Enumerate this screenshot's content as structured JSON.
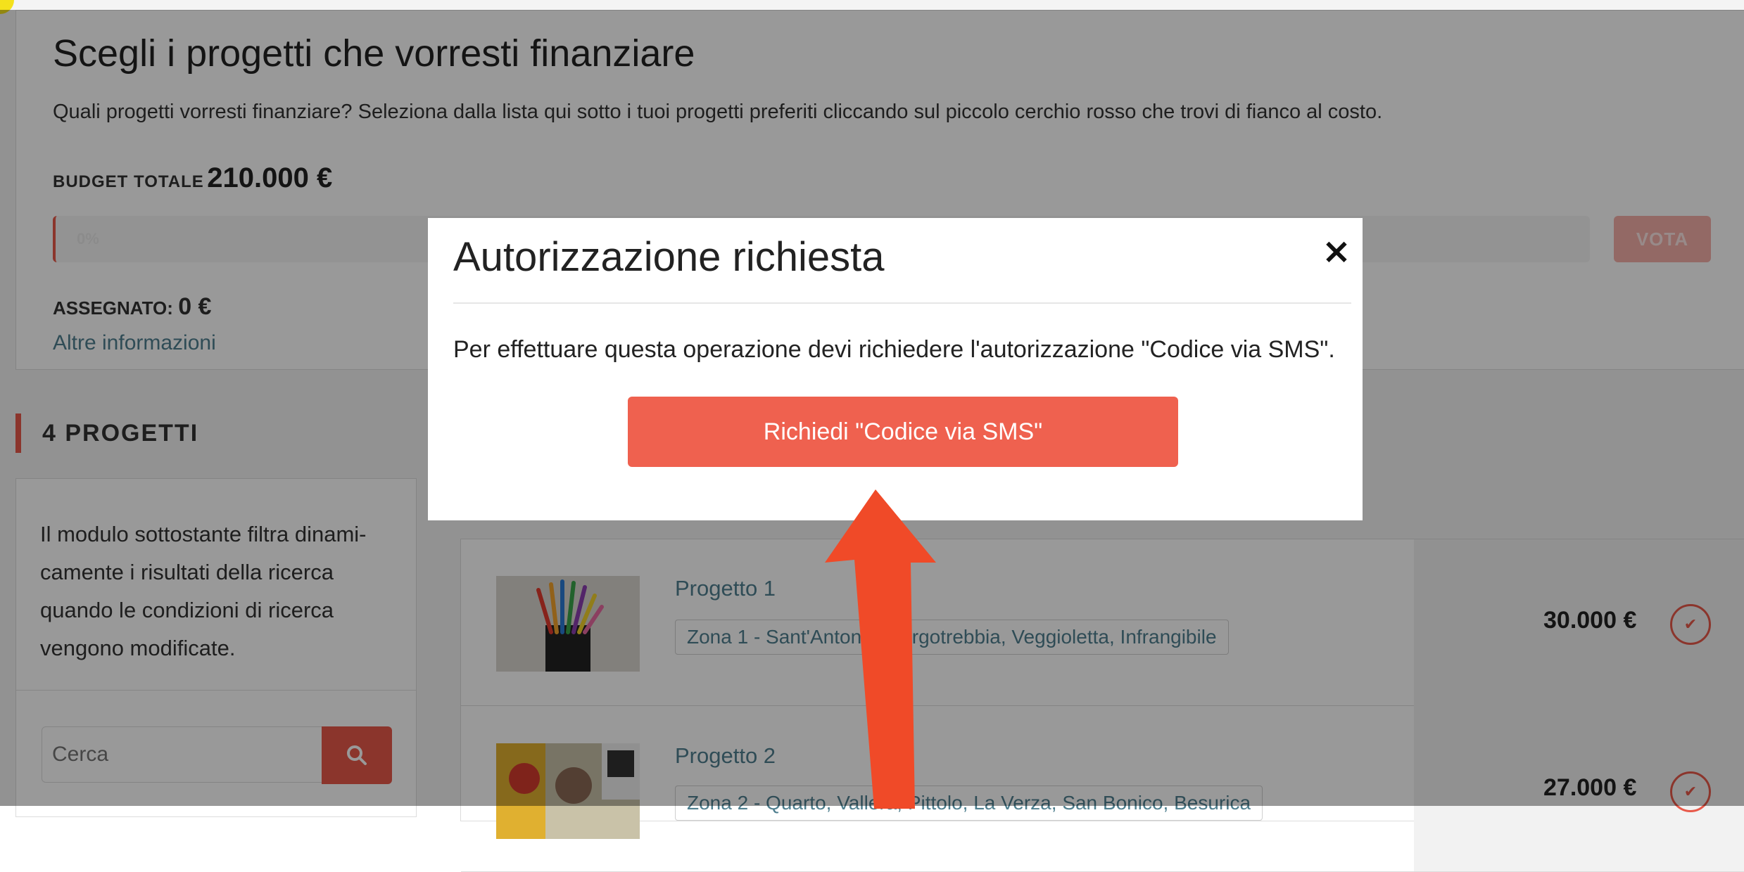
{
  "header": {
    "title": "Scegli i progetti che vorresti finanziare",
    "description": "Quali progetti vorresti finanziare? Seleziona dalla lista qui sotto i tuoi progetti preferiti cliccando sul piccolo cerchio rosso che trovi di fianco al costo.",
    "budget_label": "BUDGET TOTALE",
    "budget_value": "210.000 €",
    "progress_label": "0%",
    "progress_fraction": 0,
    "vote_button": "VOTA",
    "assigned_label": "ASSEGNATO:",
    "assigned_value": "0 €",
    "more_info_link": "Altre informazioni"
  },
  "projects": {
    "count_label": "4 PROGETTI",
    "filter_text": "Il modulo sottostante filtra dinami-camente i risultati della ricerca quando le condizioni di ricerca vengono modificate.",
    "search_placeholder": "Cerca",
    "search_icon": "search-icon",
    "items": [
      {
        "name": "Progetto 1",
        "zone": "Zona 1 - Sant'Antonio, Borgotrebbia, Veggioletta, Infrangibile",
        "cost": "30.000 €",
        "icon": "check-icon"
      },
      {
        "name": "Progetto 2",
        "zone": "Zona 2 - Quarto, Vallera, Pittolo, La Verza, San Bonico, Besurica",
        "cost": "27.000 €",
        "icon": "check-icon"
      }
    ]
  },
  "modal": {
    "title": "Autorizzazione richiesta",
    "close_glyph": "×",
    "message": "Per effettuare questa operazione devi richiedere l'autorizzazione \"Codice via SMS\".",
    "button_label": "Richiedi \"Codice via SMS\""
  },
  "colors": {
    "accent": "#e8594a",
    "button": "#ef614f",
    "link": "#4f7f8f",
    "annotation_arrow": "#f04a28"
  }
}
